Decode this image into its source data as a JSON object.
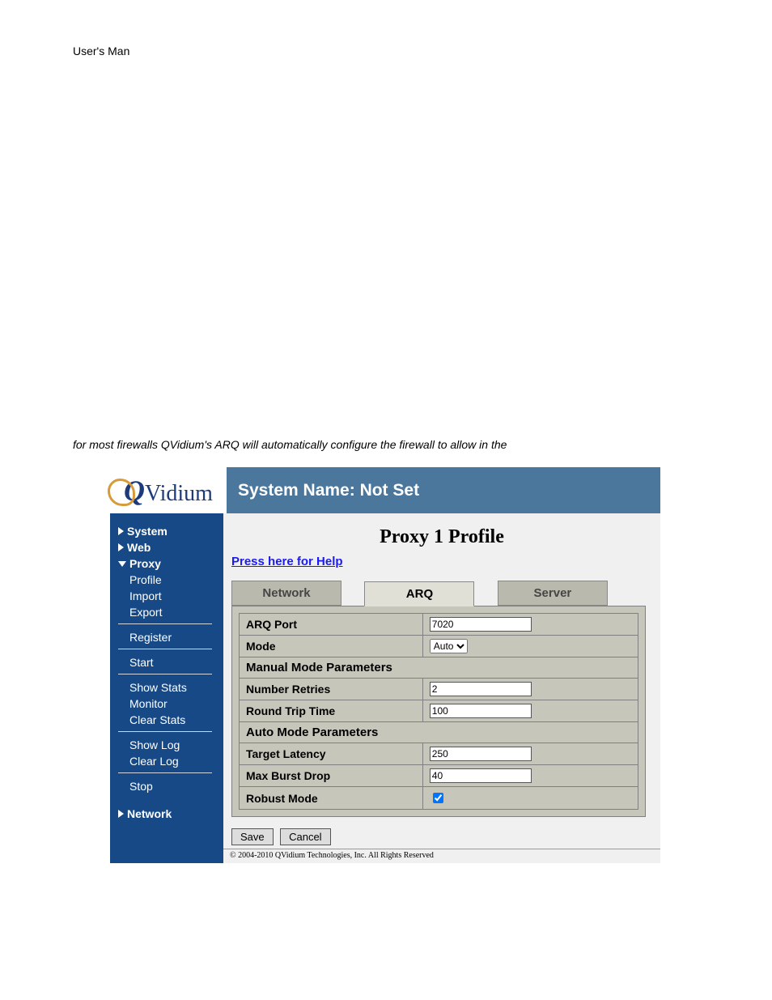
{
  "doc": {
    "header_fragment": "User's Man",
    "caption_fragment": "for most firewalls QVidium's ARQ will automatically configure the firewall to allow in the"
  },
  "header": {
    "logo_text": "Vidium",
    "system_name_label": "System Name: Not Set"
  },
  "sidebar": {
    "system": "System",
    "web": "Web",
    "proxy": "Proxy",
    "proxy_items": {
      "profile": "Profile",
      "import": "Import",
      "export": "Export",
      "register": "Register",
      "start": "Start",
      "show_stats": "Show Stats",
      "monitor": "Monitor",
      "clear_stats": "Clear Stats",
      "show_log": "Show Log",
      "clear_log": "Clear Log",
      "stop": "Stop"
    },
    "network": "Network"
  },
  "page": {
    "title": "Proxy 1 Profile",
    "help_link": "Press here for Help",
    "tabs": {
      "network": "Network",
      "arq": "ARQ",
      "server": "Server"
    },
    "active_tab": "arq"
  },
  "form": {
    "arq_port": {
      "label": "ARQ Port",
      "value": "7020"
    },
    "mode": {
      "label": "Mode",
      "value": "Auto"
    },
    "section_manual": "Manual Mode Parameters",
    "number_retries": {
      "label": "Number Retries",
      "value": "2"
    },
    "round_trip": {
      "label": "Round Trip Time",
      "value": "100"
    },
    "section_auto": "Auto Mode Parameters",
    "target_latency": {
      "label": "Target Latency",
      "value": "250"
    },
    "max_burst": {
      "label": "Max Burst Drop",
      "value": "40"
    },
    "robust_mode": {
      "label": "Robust Mode",
      "checked": true
    }
  },
  "buttons": {
    "save": "Save",
    "cancel": "Cancel"
  },
  "copyright": "© 2004-2010 QVidium Technologies, Inc.   All Rights Reserved"
}
